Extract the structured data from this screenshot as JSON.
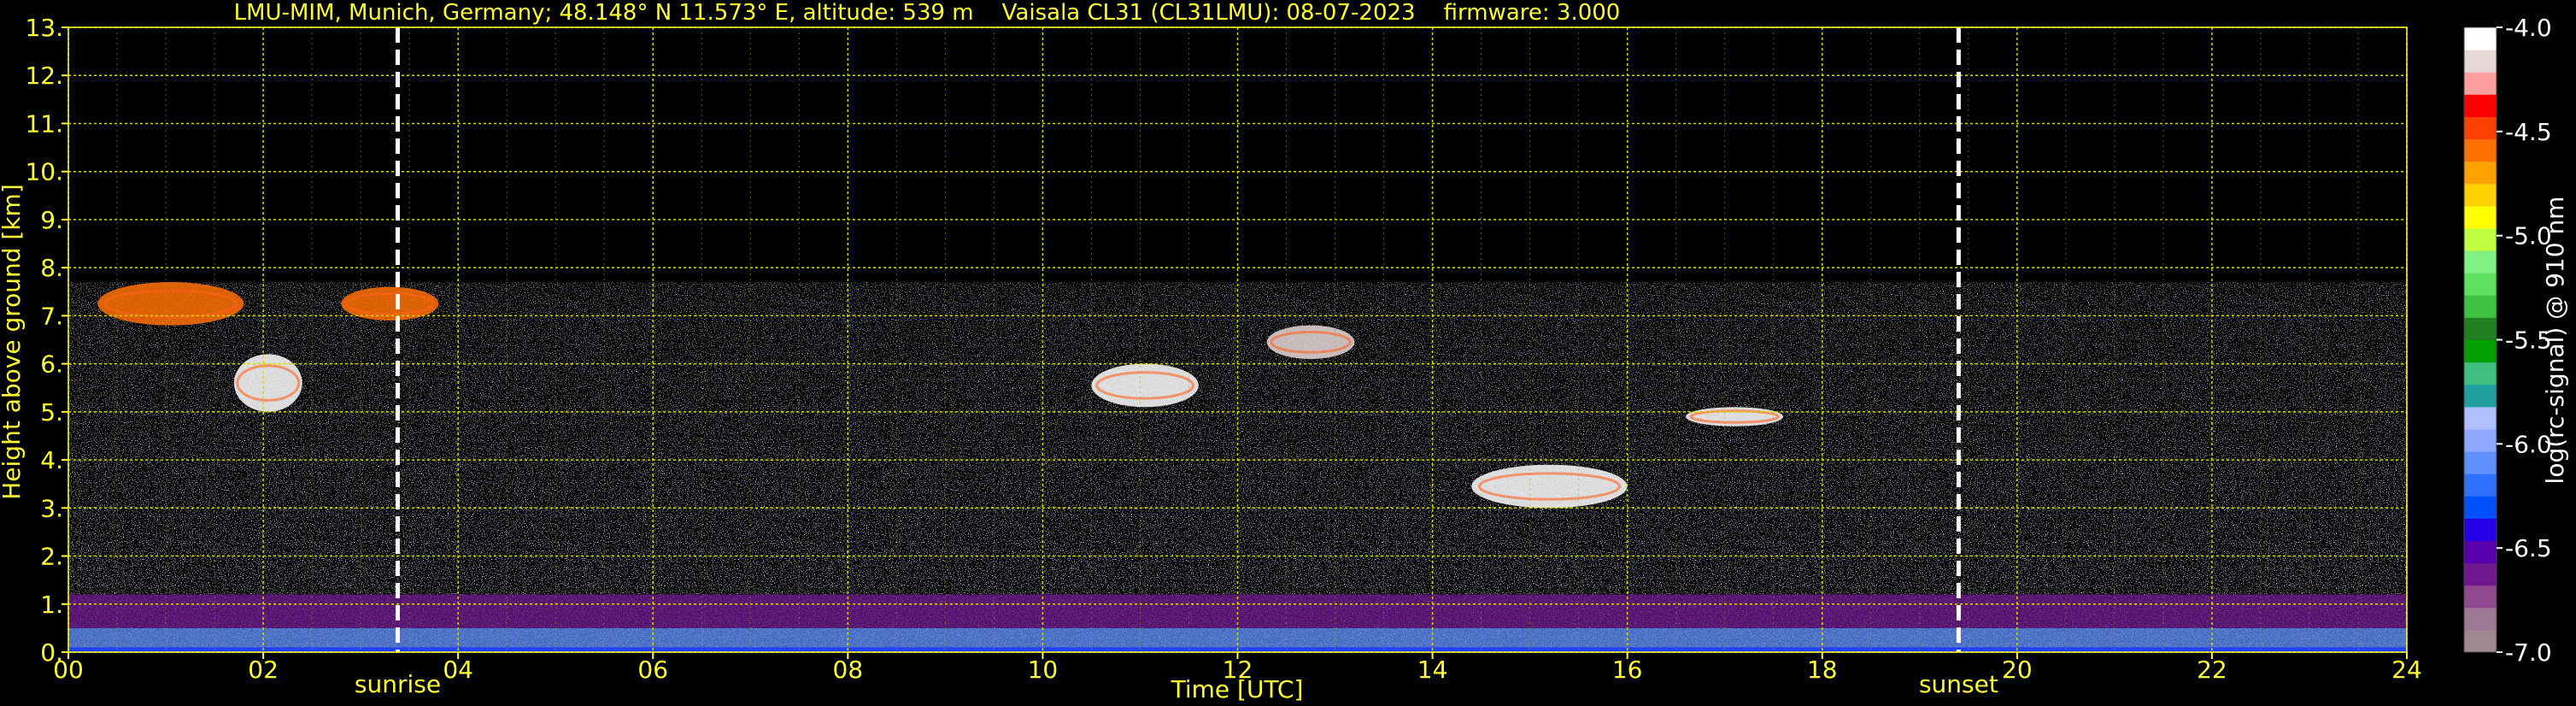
{
  "chart_data": {
    "type": "heatmap",
    "title": "LMU-MIM, Munich, Germany; 48.148° N 11.573° E, altitude: 539 m    Vaisala CL31 (CL31LMU): 08-07-2023    firmware: 3.000",
    "xlabel": "Time [UTC]",
    "ylabel": "Height above ground [km]",
    "xlim": [
      0,
      24
    ],
    "ylim": [
      0,
      13
    ],
    "x_ticks": [
      "00",
      "02",
      "04",
      "06",
      "08",
      "10",
      "12",
      "14",
      "16",
      "18",
      "20",
      "22",
      "24"
    ],
    "y_ticks": [
      "0.",
      "1.",
      "2.",
      "3.",
      "4.",
      "5.",
      "6.",
      "7.",
      "8.",
      "9.",
      "10.",
      "11.",
      "12.",
      "13."
    ],
    "grid": true,
    "data_top_km": 7.7,
    "vertical_markers": [
      {
        "label": "sunrise",
        "time_utc": 3.38
      },
      {
        "label": "sunset",
        "time_utc": 19.4
      }
    ],
    "colorbar": {
      "label": "log(rc-signal) @ 910 nm",
      "range": [
        -7.0,
        -4.0
      ],
      "tick_labels": [
        "-4.0",
        "-4.5",
        "-5.0",
        "-5.5",
        "-6.0",
        "-6.5",
        "-7.0"
      ],
      "colors": [
        "#a08890",
        "#a07898",
        "#904890",
        "#701890",
        "#5800b0",
        "#2800e8",
        "#0050ff",
        "#3070ff",
        "#6090ff",
        "#90a8ff",
        "#b0c0ff",
        "#20a0a0",
        "#40c080",
        "#00a000",
        "#208020",
        "#40c040",
        "#60e060",
        "#80f080",
        "#c0ff40",
        "#ffff00",
        "#ffd000",
        "#ffa000",
        "#ff7000",
        "#ff4000",
        "#ff0000",
        "#ffa0a0",
        "#e8d8d8",
        "#ffffff"
      ]
    },
    "aerosol_layers": [
      {
        "t_start": 0.0,
        "t_end": 24.0,
        "h_bottom": 0.0,
        "h_top": 0.5,
        "log_signal": -6.1
      },
      {
        "t_start": 0.0,
        "t_end": 24.0,
        "h_bottom": 0.5,
        "h_top": 1.2,
        "log_signal": -6.6
      }
    ],
    "cloud_features": [
      {
        "t_start": 0.3,
        "t_end": 1.8,
        "h_bottom": 6.8,
        "h_top": 7.7,
        "log_signal": -4.6
      },
      {
        "t_start": 1.7,
        "t_end": 2.4,
        "h_bottom": 5.0,
        "h_top": 6.2,
        "log_signal": -4.0
      },
      {
        "t_start": 2.8,
        "t_end": 3.8,
        "h_bottom": 6.9,
        "h_top": 7.6,
        "log_signal": -4.6
      },
      {
        "t_start": 10.5,
        "t_end": 11.6,
        "h_bottom": 5.1,
        "h_top": 6.0,
        "log_signal": -4.0
      },
      {
        "t_start": 12.3,
        "t_end": 13.2,
        "h_bottom": 6.1,
        "h_top": 6.8,
        "log_signal": -4.2
      },
      {
        "t_start": 14.4,
        "t_end": 16.0,
        "h_bottom": 3.0,
        "h_top": 3.9,
        "log_signal": -4.0
      },
      {
        "t_start": 16.6,
        "t_end": 17.6,
        "h_bottom": 4.7,
        "h_top": 5.1,
        "log_signal": -4.0
      }
    ]
  }
}
